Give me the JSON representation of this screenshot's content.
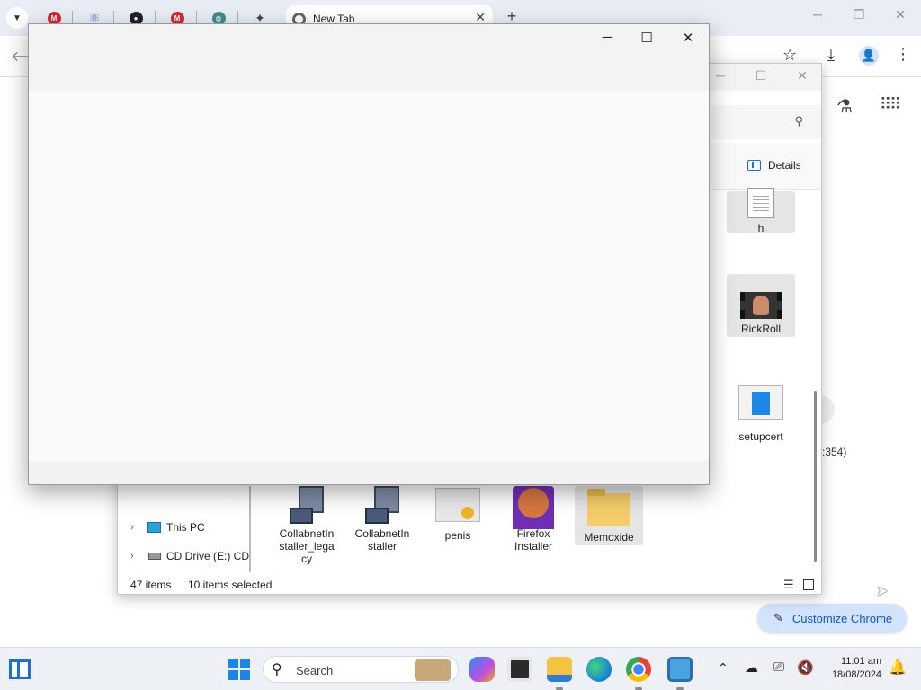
{
  "browser": {
    "active_tab_title": "New Tab",
    "toolbar": {
      "back_icon": "arrow-left-icon",
      "star_icon": "star-icon",
      "download_icon": "download-icon",
      "profile_icon": "person-icon",
      "menu_icon": "kebab-menu-icon"
    },
    "page": {
      "partial_text": ":354)",
      "customize_label": "Customize Chrome"
    }
  },
  "explorer": {
    "files": [
      {
        "name": "h",
        "icon": "text-document-icon",
        "selected": true
      },
      {
        "name": "RickRoll",
        "icon": "video-file-icon",
        "selected": true
      },
      {
        "name": "setupcert",
        "icon": "certificate-app-icon",
        "selected": false
      },
      {
        "name": "CollabnetInstaller_legacy",
        "label_lines": [
          "CollabnetIn",
          "staller_lega",
          "cy"
        ],
        "icon": "network-computer-icon",
        "selected": false
      },
      {
        "name": "CollabnetInstaller",
        "label_lines": [
          "CollabnetIn",
          "staller"
        ],
        "icon": "network-computer-icon",
        "selected": false
      },
      {
        "name": "penis",
        "icon": "image-file-icon",
        "selected": false
      },
      {
        "name": "Firefox Installer",
        "label_lines": [
          "Firefox",
          "Installer"
        ],
        "icon": "firefox-installer-icon",
        "selected": false
      },
      {
        "name": "Memoxide",
        "icon": "folder-icon",
        "selected": true
      }
    ],
    "details_label": "Details",
    "nav": [
      {
        "label": "This PC",
        "icon": "this-pc-icon"
      },
      {
        "label": "CD Drive (E:) CD",
        "icon": "cd-drive-icon"
      }
    ],
    "status": {
      "item_count": "47 items",
      "selected_count": "10 items selected"
    }
  },
  "taskbar": {
    "search_label": "Search",
    "clock_time": "11:01 am",
    "clock_date": "18/08/2024"
  },
  "colors": {
    "accent": "#0b57d0",
    "customize_bg": "#d3e3fd",
    "taskbar_bg": "#edf1f6",
    "start_blue": "#1b86e6"
  }
}
